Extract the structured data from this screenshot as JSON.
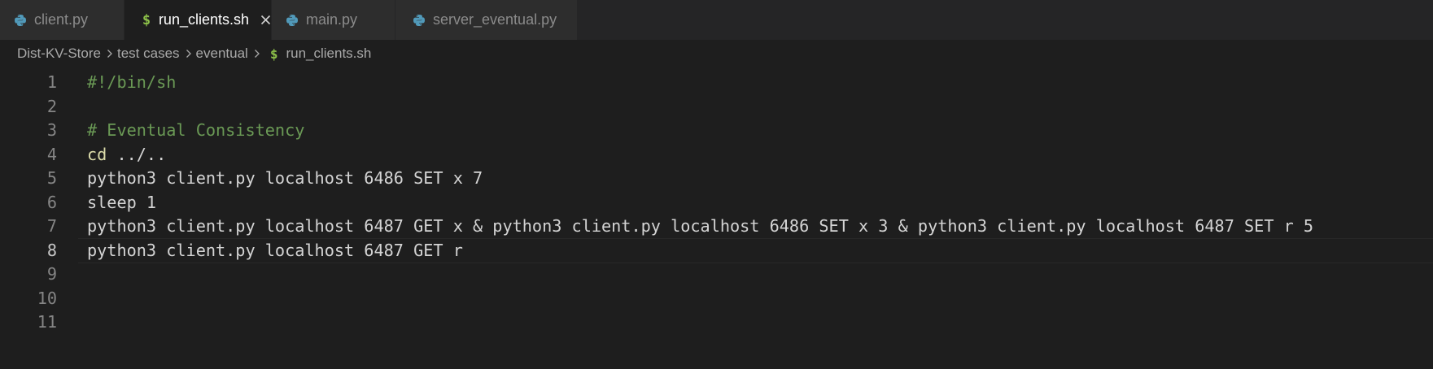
{
  "tabs": [
    {
      "label": "client.py",
      "icon": "python-icon",
      "active": false
    },
    {
      "label": "run_clients.sh",
      "icon": "shell-dollar-icon",
      "active": true
    },
    {
      "label": "main.py",
      "icon": "python-icon",
      "active": false
    },
    {
      "label": "server_eventual.py",
      "icon": "python-icon",
      "active": false
    }
  ],
  "breadcrumb": {
    "items": [
      "Dist-KV-Store",
      "test cases",
      "eventual"
    ],
    "file_icon": "$",
    "file": "run_clients.sh"
  },
  "editor": {
    "current_line": 8,
    "lines": [
      {
        "number": "1",
        "tokens": [
          {
            "text": "#!/bin/sh",
            "kind": "comment"
          }
        ]
      },
      {
        "number": "2",
        "tokens": []
      },
      {
        "number": "3",
        "tokens": [
          {
            "text": "# Eventual Consistency",
            "kind": "comment"
          }
        ]
      },
      {
        "number": "4",
        "tokens": [
          {
            "text": "cd",
            "kind": "builtin"
          },
          {
            "text": " ../..",
            "kind": "plain"
          }
        ]
      },
      {
        "number": "5",
        "tokens": [
          {
            "text": "python3 client.py localhost 6486 SET x 7",
            "kind": "plain"
          }
        ]
      },
      {
        "number": "6",
        "tokens": [
          {
            "text": "sleep 1",
            "kind": "plain"
          }
        ]
      },
      {
        "number": "7",
        "tokens": [
          {
            "text": "python3 client.py localhost 6487 GET x & python3 client.py localhost 6486 SET x 3 & python3 client.py localhost 6487 SET r 5",
            "kind": "plain"
          }
        ]
      },
      {
        "number": "8",
        "tokens": [
          {
            "text": "python3 client.py localhost 6487 GET r",
            "kind": "plain"
          }
        ]
      },
      {
        "number": "9",
        "tokens": []
      },
      {
        "number": "10",
        "tokens": []
      },
      {
        "number": "11",
        "tokens": []
      }
    ]
  },
  "colors": {
    "background": "#1e1e1e",
    "tab_inactive": "#2d2d2d",
    "comment": "#6a9955",
    "builtin": "#dcdcaa",
    "python_icon": "#519aba",
    "shell_icon": "#8dc149"
  }
}
